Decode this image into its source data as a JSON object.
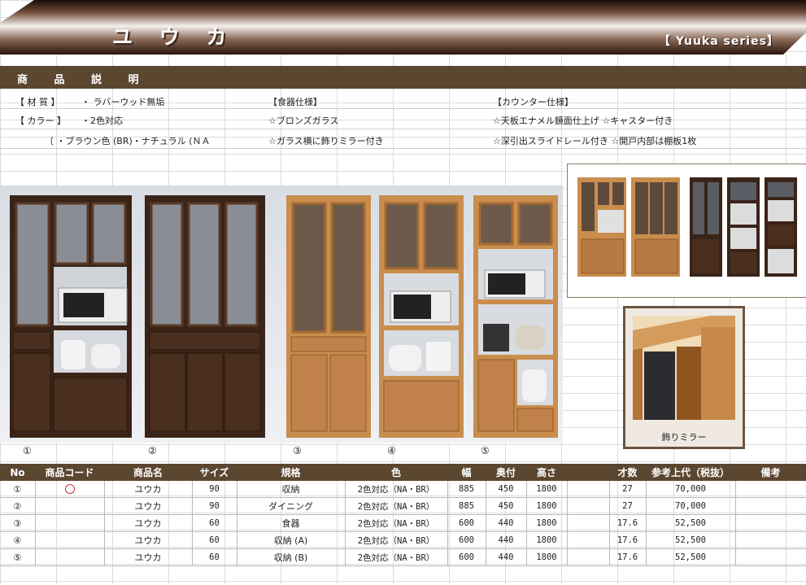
{
  "header": {
    "title": "ユ ウ カ",
    "series": "【 Yuuka series】"
  },
  "description": {
    "section_label": "商 品 説 明",
    "material_label": "【 材 質 】",
    "material_value": "・ ラバーウッド無垢",
    "color_label": "【 カラー 】",
    "color_value": "・2色対応",
    "color_detail": "〔 ・ブラウン色 (BR)・ナチュラル (ＮＡ",
    "dish_title": "【食器仕様】",
    "dish_1": "☆ブロンズガラス",
    "dish_2": "☆ガラス横に飾りミラー付き",
    "counter_title": "【カウンター仕様】",
    "counter_1": "☆天板エナメル鏡面仕上げ ☆キャスター付き",
    "counter_2": "☆深引出スライドレール付き ☆開戸内部は棚板1枚"
  },
  "product_numbers": [
    "①",
    "②",
    "③",
    "④",
    "⑤"
  ],
  "mirror_caption": "飾りミラー",
  "colors": {
    "brown": "#3a2418",
    "natural": "#c98d4e",
    "bar": "#5b4630"
  },
  "table": {
    "headers": [
      "No",
      "商品コード",
      "商品名",
      "サイズ",
      "規格",
      "色",
      "幅",
      "奥付",
      "高さ",
      "",
      "才数",
      "参考上代（税抜）",
      "備考"
    ],
    "rows": [
      [
        "①",
        "○",
        "ユウカ",
        "90",
        "収納",
        "2色対応（NA・BR）",
        "885",
        "450",
        "1800",
        "",
        "27",
        "70,000",
        ""
      ],
      [
        "②",
        "",
        "ユウカ",
        "90",
        "ダイニング",
        "2色対応（NA・BR）",
        "885",
        "450",
        "1800",
        "",
        "27",
        "70,000",
        ""
      ],
      [
        "③",
        "",
        "ユウカ",
        "60",
        "食器",
        "2色対応（NA・BR）",
        "600",
        "440",
        "1800",
        "",
        "17.6",
        "52,500",
        ""
      ],
      [
        "④",
        "",
        "ユウカ",
        "60",
        "収納 (A)",
        "2色対応（NA・BR）",
        "600",
        "440",
        "1800",
        "",
        "17.6",
        "52,500",
        ""
      ],
      [
        "⑤",
        "",
        "ユウカ",
        "60",
        "収納 (B)",
        "2色対応（NA・BR）",
        "600",
        "440",
        "1800",
        "",
        "17.6",
        "52,500",
        ""
      ]
    ]
  }
}
